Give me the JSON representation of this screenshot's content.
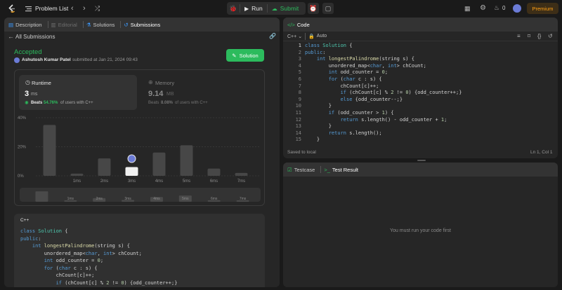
{
  "topbar": {
    "problem_list": "Problem List",
    "run": "Run",
    "submit": "Submit",
    "points": "0",
    "premium": "Premium"
  },
  "left_tabs": {
    "description": "Description",
    "editorial": "Editorial",
    "solutions": "Solutions",
    "submissions": "Submissions"
  },
  "submission": {
    "back": "All Submissions",
    "status": "Accepted",
    "author": "Ashutosh Kumar Patel",
    "submitted": "submitted at Jan 21, 2024 09:43",
    "solution_btn": "Solution"
  },
  "runtime": {
    "label": "Runtime",
    "value": "3",
    "unit": "ms",
    "beats_prefix": "Beats",
    "beats": "54.76%",
    "beats_suffix": "of users with C++"
  },
  "memory": {
    "label": "Memory",
    "value": "9.14",
    "unit": "MB",
    "beats_prefix": "Beats",
    "beats": "8.08%",
    "beats_suffix": "of users with C++"
  },
  "chart_data": {
    "type": "bar",
    "ytick_labels": [
      "40%",
      "20%",
      "0%"
    ],
    "ylim": [
      0,
      40
    ],
    "categories": [
      "",
      "1ms",
      "2ms",
      "3ms",
      "4ms",
      "5ms",
      "6ms",
      "7ms"
    ],
    "values": [
      35,
      1.5,
      12,
      6,
      16,
      21,
      5,
      2
    ],
    "highlight": 3
  },
  "code_lang_label": "C++",
  "code_tabs": {
    "code": "Code",
    "lang": "C++",
    "auto": "Auto"
  },
  "code_lines": [
    [
      [
        "kw",
        "class "
      ],
      [
        "ty",
        "Solution "
      ],
      [
        "pl",
        "{"
      ]
    ],
    [
      [
        "kw",
        "public"
      ],
      [
        "pl",
        ":"
      ]
    ],
    [
      [
        "pl",
        "    "
      ],
      [
        "kw",
        "int "
      ],
      [
        "fn",
        "longestPalindrome"
      ],
      [
        "pl",
        "(string s) {"
      ]
    ],
    [
      [
        "pl",
        "        unordered_map<"
      ],
      [
        "kw",
        "char"
      ],
      [
        "pl",
        ", "
      ],
      [
        "kw",
        "int"
      ],
      [
        "pl",
        "> chCount;"
      ]
    ],
    [
      [
        "pl",
        "        "
      ],
      [
        "kw",
        "int "
      ],
      [
        "pl",
        "odd_counter = "
      ],
      [
        "nu",
        "0"
      ],
      [
        "pl",
        ";"
      ]
    ],
    [
      [
        "pl",
        "        "
      ],
      [
        "kw",
        "for "
      ],
      [
        "pl",
        "("
      ],
      [
        "kw",
        "char "
      ],
      [
        "pl",
        "c : s) {"
      ]
    ],
    [
      [
        "pl",
        "            chCount[c]++;"
      ]
    ],
    [
      [
        "pl",
        "            "
      ],
      [
        "kw",
        "if "
      ],
      [
        "pl",
        "(chCount[c] % "
      ],
      [
        "nu",
        "2"
      ],
      [
        "pl",
        " != "
      ],
      [
        "nu",
        "0"
      ],
      [
        "pl",
        ") {odd_counter++;}"
      ]
    ],
    [
      [
        "pl",
        "            "
      ],
      [
        "kw",
        "else "
      ],
      [
        "pl",
        "{odd_counter--;}"
      ]
    ],
    [
      [
        "pl",
        "        }"
      ]
    ],
    [
      [
        "pl",
        "        "
      ],
      [
        "kw",
        "if "
      ],
      [
        "pl",
        "(odd_counter > "
      ],
      [
        "nu",
        "1"
      ],
      [
        "pl",
        ") {"
      ]
    ],
    [
      [
        "pl",
        "            "
      ],
      [
        "kw",
        "return "
      ],
      [
        "pl",
        "s.length() - odd_counter + "
      ],
      [
        "nu",
        "1"
      ],
      [
        "pl",
        ";"
      ]
    ],
    [
      [
        "pl",
        "        }"
      ]
    ],
    [
      [
        "pl",
        "        "
      ],
      [
        "kw",
        "return "
      ],
      [
        "pl",
        "s.length();"
      ]
    ],
    [
      [
        "pl",
        "    }"
      ]
    ]
  ],
  "editor_status": {
    "saved": "Saved to local",
    "position": "Ln 1, Col 1"
  },
  "test_tabs": {
    "testcase": "Testcase",
    "result": "Test Result"
  },
  "test_message": "You must run your code first"
}
